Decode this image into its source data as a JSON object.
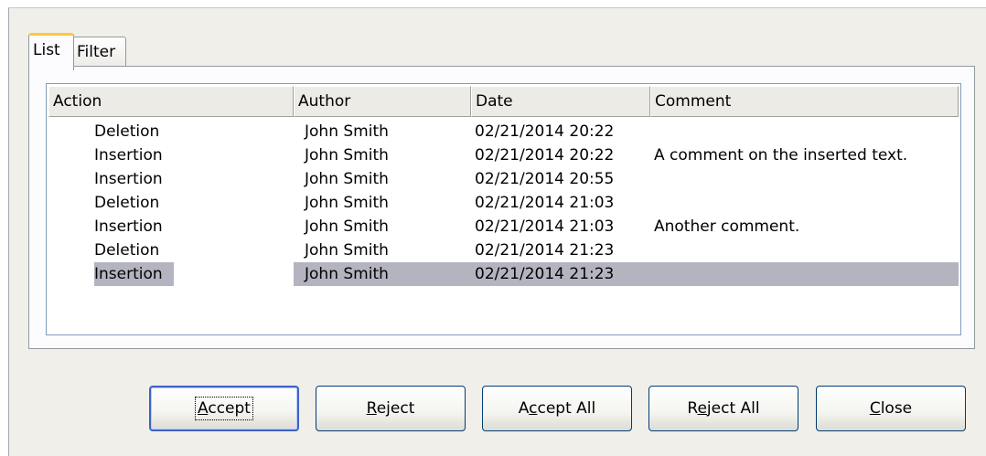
{
  "tabs": [
    {
      "label": "List",
      "selected": true
    },
    {
      "label": "Filter",
      "selected": false
    }
  ],
  "list": {
    "columns": [
      "Action",
      "Author",
      "Date",
      "Comment"
    ],
    "rows": [
      {
        "action": "Deletion",
        "author": "John Smith",
        "date": "02/21/2014 20:22",
        "comment": ""
      },
      {
        "action": "Insertion",
        "author": "John Smith",
        "date": "02/21/2014 20:22",
        "comment": "A comment on the inserted text."
      },
      {
        "action": "Insertion",
        "author": "John Smith",
        "date": "02/21/2014 20:55",
        "comment": ""
      },
      {
        "action": "Deletion",
        "author": "John Smith",
        "date": "02/21/2014 21:03",
        "comment": ""
      },
      {
        "action": "Insertion",
        "author": "John Smith",
        "date": "02/21/2014 21:03",
        "comment": "Another comment."
      },
      {
        "action": "Deletion",
        "author": "John Smith",
        "date": "02/21/2014 21:23",
        "comment": ""
      },
      {
        "action": "Insertion",
        "author": "John Smith",
        "date": "02/21/2014 21:23",
        "comment": "",
        "selected": true
      }
    ],
    "selection_color": "#b4b4c0"
  },
  "buttons": {
    "accept": {
      "pre": "",
      "key": "A",
      "post": "ccept"
    },
    "reject": {
      "pre": "",
      "key": "R",
      "post": "eject"
    },
    "accept_all": {
      "pre": "A",
      "key": "c",
      "post": "cept All"
    },
    "reject_all": {
      "pre": "R",
      "key": "e",
      "post": "ject All"
    },
    "close": {
      "pre": "",
      "key": "C",
      "post": "lose"
    }
  },
  "colors": {
    "dialog_bg": "#f0efea",
    "default_button_border": "#3d62c8",
    "active_tab_accent": "#ffc83c"
  }
}
